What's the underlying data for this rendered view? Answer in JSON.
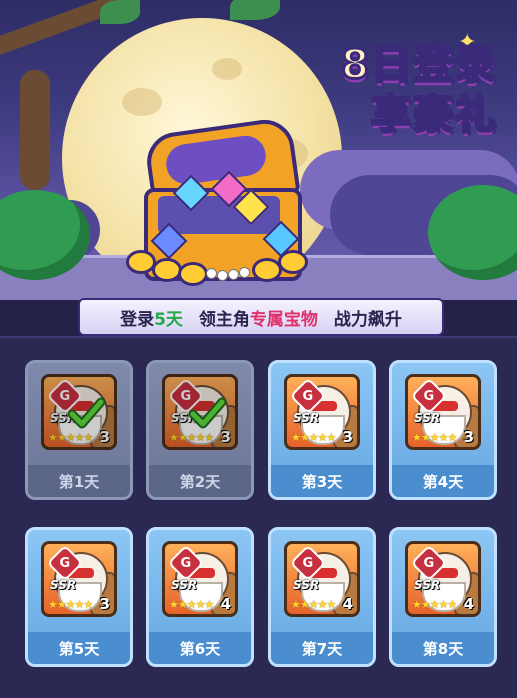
{
  "event": {
    "title_line1": "8日登录",
    "title_line2": "享豪礼",
    "banner": {
      "part1_prefix": "登录",
      "part1_highlight": "5天",
      "part2_prefix": "领主角",
      "part2_highlight": "专属宝物",
      "part3": "战力飙升"
    }
  },
  "rewards": [
    {
      "day": "第1天",
      "rarity": "SSR",
      "badge": "G",
      "stars": "★★★★★",
      "count": "3",
      "claimed": true
    },
    {
      "day": "第2天",
      "rarity": "SSR",
      "badge": "G",
      "stars": "★★★★★",
      "count": "3",
      "claimed": true
    },
    {
      "day": "第3天",
      "rarity": "SSR",
      "badge": "G",
      "stars": "★★★★★",
      "count": "3",
      "claimed": false
    },
    {
      "day": "第4天",
      "rarity": "SSR",
      "badge": "G",
      "stars": "★★★★★",
      "count": "3",
      "claimed": false
    },
    {
      "day": "第5天",
      "rarity": "SSR",
      "badge": "G",
      "stars": "★★★★★",
      "count": "3",
      "claimed": false
    },
    {
      "day": "第6天",
      "rarity": "SSR",
      "badge": "G",
      "stars": "★★★★★",
      "count": "4",
      "claimed": false
    },
    {
      "day": "第7天",
      "rarity": "SSR",
      "badge": "G",
      "stars": "★★★★★",
      "count": "4",
      "claimed": false
    },
    {
      "day": "第8天",
      "rarity": "SSR",
      "badge": "G",
      "stars": "★★★★★",
      "count": "4",
      "claimed": false
    }
  ],
  "colors": {
    "panel_bg": "#2b2854",
    "card_active": "#64a7e2",
    "card_claimed": "#6c7697",
    "highlight_green": "#24a84a",
    "highlight_red": "#e0306a"
  }
}
